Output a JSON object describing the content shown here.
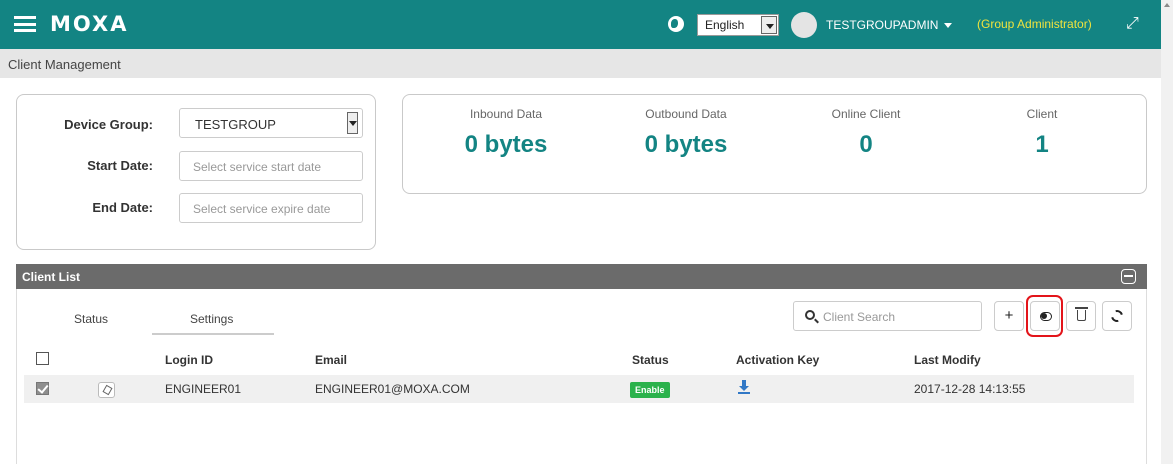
{
  "header": {
    "brand": "MOXA",
    "language": "English",
    "username": "TESTGROUPADMIN",
    "role": "(Group Administrator)"
  },
  "breadcrumb": "Client Management",
  "filters": {
    "device_group_label": "Device Group:",
    "device_group_value": "TESTGROUP",
    "start_date_label": "Start Date:",
    "start_date_placeholder": "Select service start date",
    "end_date_label": "End Date:",
    "end_date_placeholder": "Select service expire date"
  },
  "stats": [
    {
      "label": "Inbound Data",
      "value": "0 bytes"
    },
    {
      "label": "Outbound Data",
      "value": "0 bytes"
    },
    {
      "label": "Online Client",
      "value": "0"
    },
    {
      "label": "Client",
      "value": "1"
    }
  ],
  "client_list": {
    "title": "Client List",
    "tabs": [
      "Status",
      "Settings"
    ],
    "search_placeholder": "Client Search",
    "add_label": "+",
    "columns": [
      "Login ID",
      "Email",
      "Status",
      "Activation Key",
      "Last Modify"
    ],
    "rows": [
      {
        "login_id": "ENGINEER01",
        "email": "ENGINEER01@MOXA.COM",
        "status": "Enable",
        "last_modify": "2017-12-28 14:13:55"
      }
    ]
  },
  "colors": {
    "brand_teal": "#138483",
    "role_yellow": "#f0e33d",
    "highlight_red": "#e3141a",
    "status_green": "#2bb24c"
  }
}
